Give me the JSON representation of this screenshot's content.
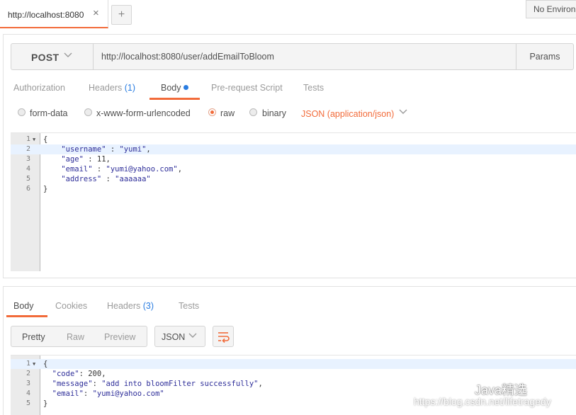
{
  "tabbar": {
    "tab_title": "http://localhost:8080",
    "close_glyph": "×",
    "add_glyph": "+",
    "environment": "No Environment"
  },
  "request": {
    "method": "POST",
    "url": "http://localhost:8080/user/addEmailToBloom",
    "params_label": "Params",
    "tabs": {
      "authorization": "Authorization",
      "headers": "Headers",
      "headers_count": "(1)",
      "body": "Body",
      "prerequest": "Pre-request Script",
      "tests": "Tests"
    },
    "body_types": {
      "form_data": "form-data",
      "urlencoded": "x-www-form-urlencoded",
      "raw": "raw",
      "binary": "binary",
      "selected": "raw",
      "content_type": "JSON (application/json)"
    },
    "lines": [
      {
        "n": "1",
        "text": "{"
      },
      {
        "n": "2",
        "text": "    \"username\" : \"yumi\","
      },
      {
        "n": "3",
        "text": "    \"age\" : 11,"
      },
      {
        "n": "4",
        "text": "    \"email\" : \"yumi@yahoo.com\","
      },
      {
        "n": "5",
        "text": "    \"address\" : \"aaaaaa\""
      },
      {
        "n": "6",
        "text": "}"
      }
    ]
  },
  "response": {
    "tabs": {
      "body": "Body",
      "cookies": "Cookies",
      "headers": "Headers",
      "headers_count": "(3)",
      "tests": "Tests"
    },
    "views": {
      "pretty": "Pretty",
      "raw": "Raw",
      "preview": "Preview"
    },
    "format": "JSON",
    "lines": [
      {
        "n": "1",
        "text": "{"
      },
      {
        "n": "2",
        "text": "  \"code\": 200,"
      },
      {
        "n": "3",
        "text": "  \"message\": \"add into bloomFilter successfully\","
      },
      {
        "n": "4",
        "text": "  \"email\": \"yumi@yahoo.com\""
      },
      {
        "n": "5",
        "text": "}"
      }
    ]
  },
  "watermark": {
    "brand": "Java精选",
    "url": "https://blog.csdn.net/lifetragedy"
  },
  "colors": {
    "accent": "#f26b3a",
    "link_blue": "#2a7de1",
    "json_string": "#2e2e99"
  }
}
